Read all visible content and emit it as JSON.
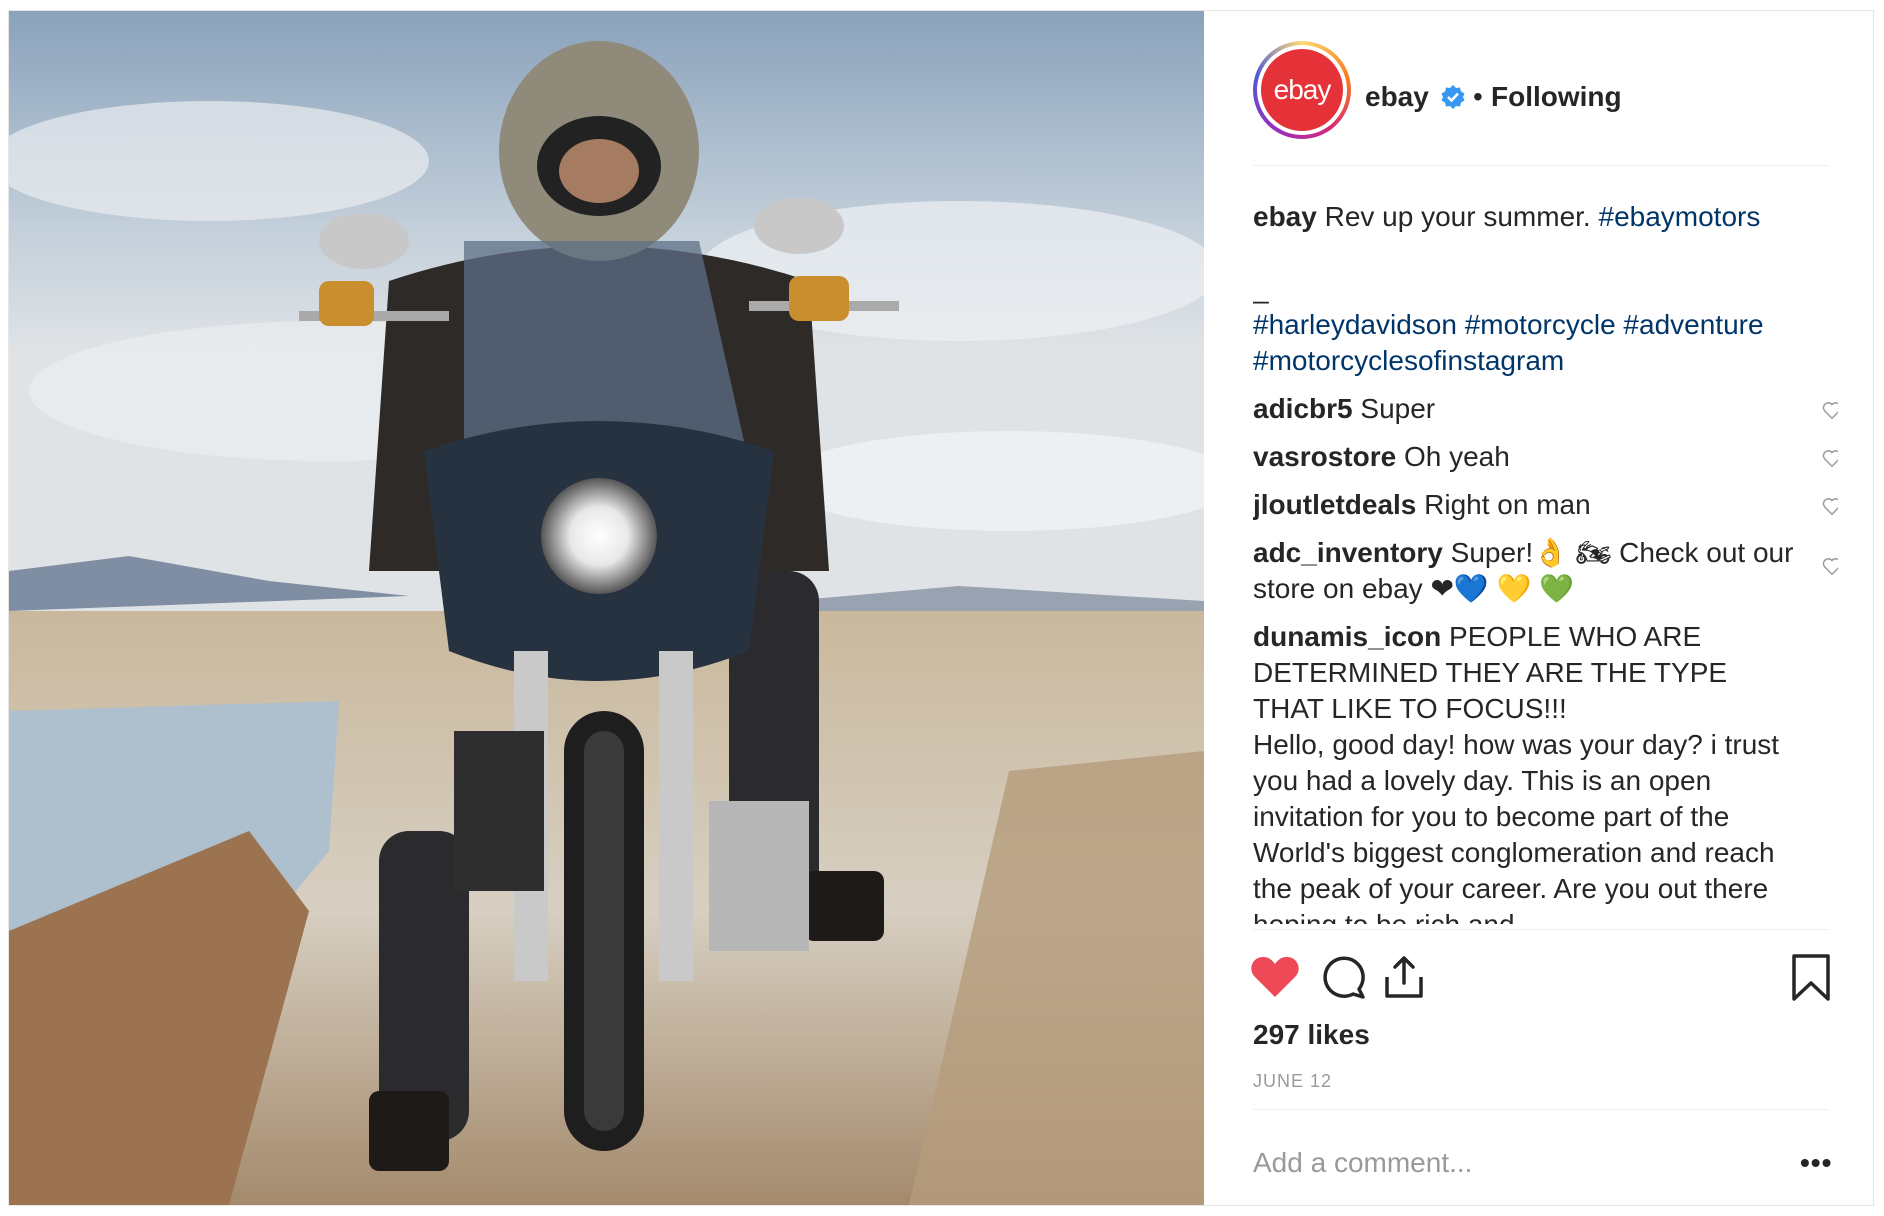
{
  "post": {
    "image_alt": "Motorcycle rider on a salt flat"
  },
  "header": {
    "avatar_text": "ebay",
    "username": "ebay",
    "separator": "•",
    "follow_status": "Following"
  },
  "caption": {
    "username": "ebay",
    "text": "Rev up your summer.",
    "tag1": "#ebaymotors",
    "dash": "_",
    "tags": [
      "#harleydavidson",
      "#motorcycle",
      "#adventure",
      "#motorcyclesofinstagram"
    ]
  },
  "comments": [
    {
      "user": "adicbr5",
      "text": "Super"
    },
    {
      "user": "vasrostore",
      "text": "Oh yeah"
    },
    {
      "user": "jloutletdeals",
      "text": "Right on man"
    },
    {
      "user": "adc_inventory",
      "text": "Super!👌  🏍  Check out our store on ebay ❤💙 💛 💚"
    },
    {
      "user": "dunamis_icon",
      "text": "PEOPLE WHO ARE DETERMINED THEY ARE THE TYPE THAT LIKE TO FOCUS!!!\nHello, good day! how was your day? i trust you had a lovely day. This is an open invitation for you to become part of the World's biggest conglomeration and reach the peak of your career. Are you out there hoping to be rich and"
    }
  ],
  "stats": {
    "likes": "297 likes",
    "date": "JUNE 12"
  },
  "add_comment": {
    "placeholder": "Add a comment...",
    "more": "•••"
  },
  "colors": {
    "liked_heart": "#ed4956",
    "hashtag": "#003569",
    "verified": "#3897f0",
    "ebay_red": "#e53238"
  }
}
